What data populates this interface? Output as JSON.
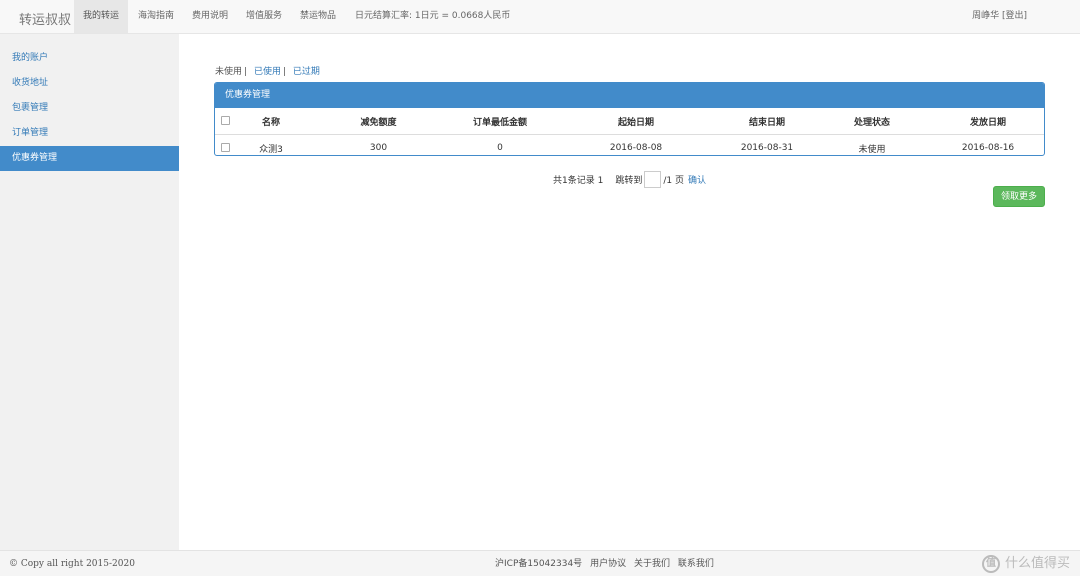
{
  "header": {
    "brand": "转运叔叔",
    "nav": [
      "我的转运",
      "海淘指南",
      "费用说明",
      "增值服务",
      "禁运物品"
    ],
    "exchange_rate": "日元结算汇率: 1日元 = 0.0668人民币",
    "user": "周峥华 [登出]"
  },
  "sidebar": {
    "items": [
      "我的账户",
      "收货地址",
      "包裹管理",
      "订单管理",
      "优惠券管理"
    ],
    "active": "优惠券管理"
  },
  "filter": {
    "unused": "未使用",
    "used": "已使用",
    "expired": "已过期"
  },
  "panel": {
    "title": "优惠券管理",
    "columns": [
      "名称",
      "减免额度",
      "订单最低金额",
      "起始日期",
      "结束日期",
      "处理状态",
      "发放日期"
    ],
    "rows": [
      [
        "众测3",
        "300",
        "0",
        "2016-08-08",
        "2016-08-31",
        "未使用",
        "2016-08-16"
      ]
    ]
  },
  "pager": {
    "summary": "共1条记录 1",
    "jump_to": "跳转到",
    "page_input": "",
    "total_pages": "/1 页",
    "confirm": "确认"
  },
  "more_button": "领取更多",
  "footer": {
    "copyright": "© Copy all right 2015-2020",
    "links": [
      "沪ICP备15042334号",
      "用户协议",
      "关于我们",
      "联系我们"
    ],
    "watermark": "什么值得买",
    "watermark_icon_glyph": "值"
  },
  "colors": {
    "primary": "#428bca",
    "success": "#5cb85c",
    "link": "#337ab7"
  }
}
